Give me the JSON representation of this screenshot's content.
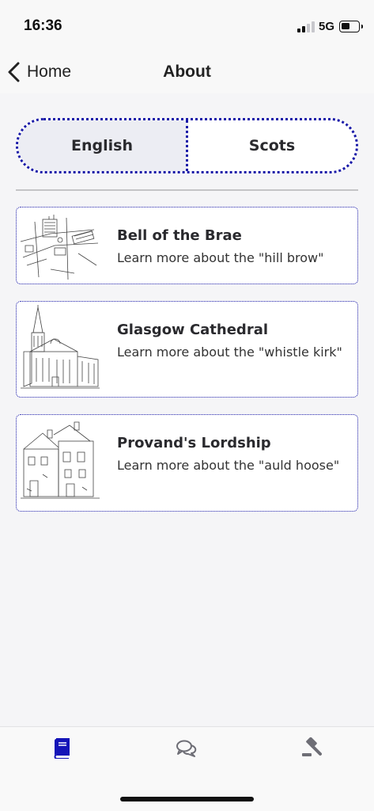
{
  "status_bar": {
    "time": "16:36",
    "network": "5G"
  },
  "nav": {
    "back_label": "Home",
    "title": "About"
  },
  "language_toggle": {
    "options": [
      "English",
      "Scots"
    ],
    "selected": "English"
  },
  "cards": [
    {
      "title": "Bell of the Brae",
      "subtitle": "Learn more about the \"hill brow\"",
      "image_icon": "street-sketch-illustration"
    },
    {
      "title": "Glasgow Cathedral",
      "subtitle": "Learn more about the \"whistle kirk\"",
      "image_icon": "cathedral-sketch-illustration"
    },
    {
      "title": "Provand's Lordship",
      "subtitle": "Learn more about the \"auld hoose\"",
      "image_icon": "house-sketch-illustration"
    }
  ],
  "tab_bar": {
    "tabs": [
      {
        "icon": "book-icon",
        "active": true
      },
      {
        "icon": "chat-bubbles-icon",
        "active": false
      },
      {
        "icon": "gavel-icon",
        "active": false
      }
    ],
    "active_color": "#1414b8",
    "inactive_color": "#6e6e76"
  },
  "accent_color": "#1a1aa8"
}
